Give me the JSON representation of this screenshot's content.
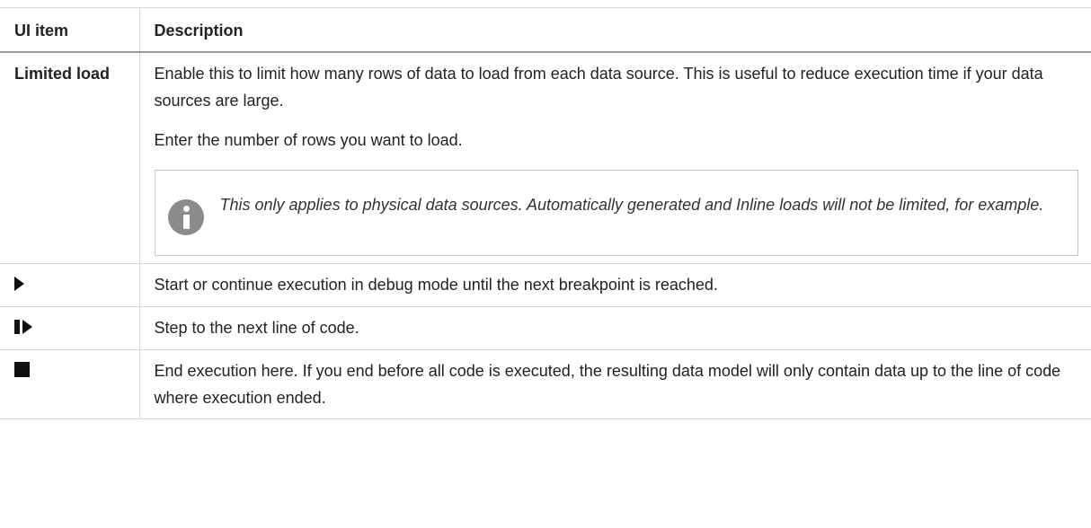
{
  "colors": {
    "border": "#d9d9d9",
    "header_rule": "#9a9a9a",
    "note_border": "#c6c6c6",
    "info_icon": "#8c8c8c",
    "text": "#222222"
  },
  "table": {
    "headers": {
      "item": "UI item",
      "description": "Description"
    },
    "limited_load": {
      "item": "Limited load",
      "description_1": "Enable this to limit how many rows of data to load from each data source. This is useful to reduce execution time if your data sources are large.",
      "description_2": "Enter the number of rows you want to load.",
      "note_icon": "info-icon",
      "note": "This only applies to physical data sources. Automatically generated and Inline loads will not be limited, for example."
    },
    "run": {
      "icon": "play-icon",
      "description": "Start or continue execution in debug mode until the next breakpoint is reached."
    },
    "step": {
      "icon": "step-icon",
      "description": "Step to the next line of code."
    },
    "stop": {
      "icon": "stop-icon",
      "description": "End execution here. If you end before all code is executed, the resulting data model will only contain data up to the line of code where execution ended."
    }
  }
}
